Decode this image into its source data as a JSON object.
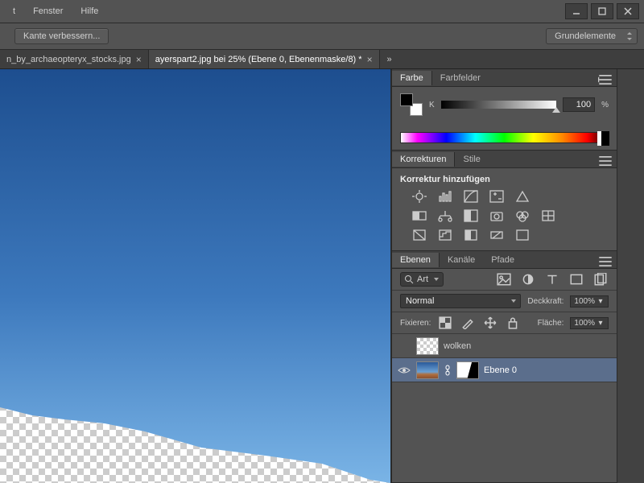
{
  "menu": {
    "t": "t",
    "fenster": "Fenster",
    "hilfe": "Hilfe"
  },
  "options": {
    "refine": "Kante verbessern...",
    "workspace": "Grundelemente"
  },
  "tabs": {
    "t1": "n_by_archaeopteryx_stocks.jpg",
    "t2": "ayerspart2.jpg bei 25% (Ebene 0, Ebenenmaske/8) *"
  },
  "color": {
    "tab_farbe": "Farbe",
    "tab_felder": "Farbfelder",
    "channel": "K",
    "value": "100",
    "unit": "%"
  },
  "corrections": {
    "tab_korr": "Korrekturen",
    "tab_stile": "Stile",
    "heading": "Korrektur hinzufügen"
  },
  "layers": {
    "tab_ebenen": "Ebenen",
    "tab_kanale": "Kanäle",
    "tab_pfade": "Pfade",
    "filter_kind": "Art",
    "blend": "Normal",
    "opacity_label": "Deckkraft:",
    "opacity_val": "100%",
    "lock_label": "Fixieren:",
    "fill_label": "Fläche:",
    "fill_val": "100%",
    "layer_wolken": "wolken",
    "layer_ebene0": "Ebene 0"
  }
}
